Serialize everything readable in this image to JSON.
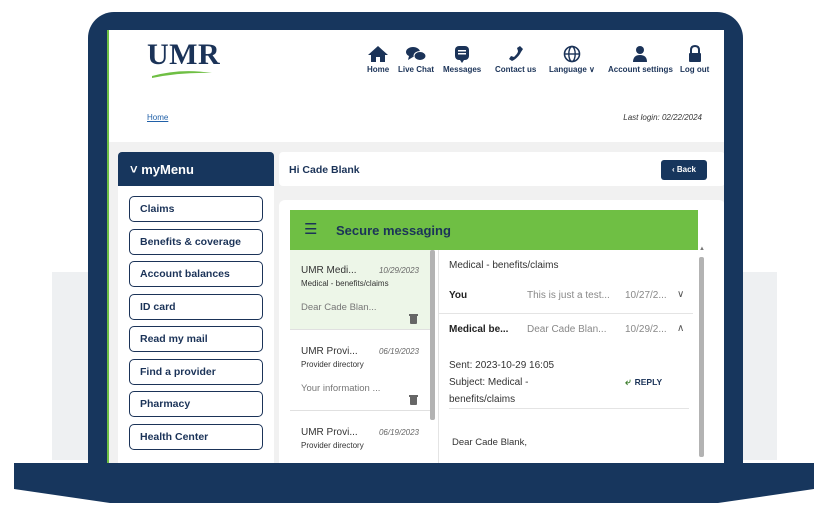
{
  "header": {
    "logo_text": "UMR",
    "nav": [
      {
        "label": "Home",
        "icon": "home-icon"
      },
      {
        "label": "Live Chat",
        "icon": "chat-icon"
      },
      {
        "label": "Messages",
        "icon": "messages-icon"
      },
      {
        "label": "Contact us",
        "icon": "phone-icon"
      },
      {
        "label": "Language ∨",
        "icon": "globe-icon"
      },
      {
        "label": "Account settings",
        "icon": "person-icon"
      },
      {
        "label": "Log out",
        "icon": "lock-icon"
      }
    ],
    "breadcrumb": "Home",
    "last_login": "Last login: 02/22/2024"
  },
  "menu": {
    "title": "˅ myMenu",
    "items": [
      "Claims",
      "Benefits & coverage",
      "Account balances",
      "ID card",
      "Read my mail",
      "Find a provider",
      "Pharmacy",
      "Health Center"
    ]
  },
  "greeting": {
    "text": "Hi Cade Blank",
    "back_label": "‹ Back"
  },
  "messaging": {
    "title": "Secure messaging",
    "threads": [
      {
        "sender": "UMR Medi...",
        "date": "10/29/2023",
        "category": "Medical - benefits/claims",
        "preview": "Dear Cade Blan..."
      },
      {
        "sender": "UMR Provi...",
        "date": "06/19/2023",
        "category": "Provider directory",
        "preview": "Your information ..."
      },
      {
        "sender": "UMR Provi...",
        "date": "06/19/2023",
        "category": "Provider directory",
        "preview": ""
      }
    ],
    "detail": {
      "category": "Medical - benefits/claims",
      "rows": [
        {
          "from": "You",
          "snippet": "This is just a test...",
          "date": "10/27/2...",
          "chevron": "∨"
        },
        {
          "from": "Medical be...",
          "snippet": "Dear Cade Blan...",
          "date": "10/29/2...",
          "chevron": "∧"
        }
      ],
      "sent": "Sent: 2023-10-29 16:05",
      "subject_line1": "Subject: Medical -",
      "subject_line2": "benefits/claims",
      "reply_label": "REPLY",
      "body_greeting": "Dear Cade Blank,"
    }
  },
  "colors": {
    "navy": "#17365d",
    "green": "#6fbf44"
  }
}
